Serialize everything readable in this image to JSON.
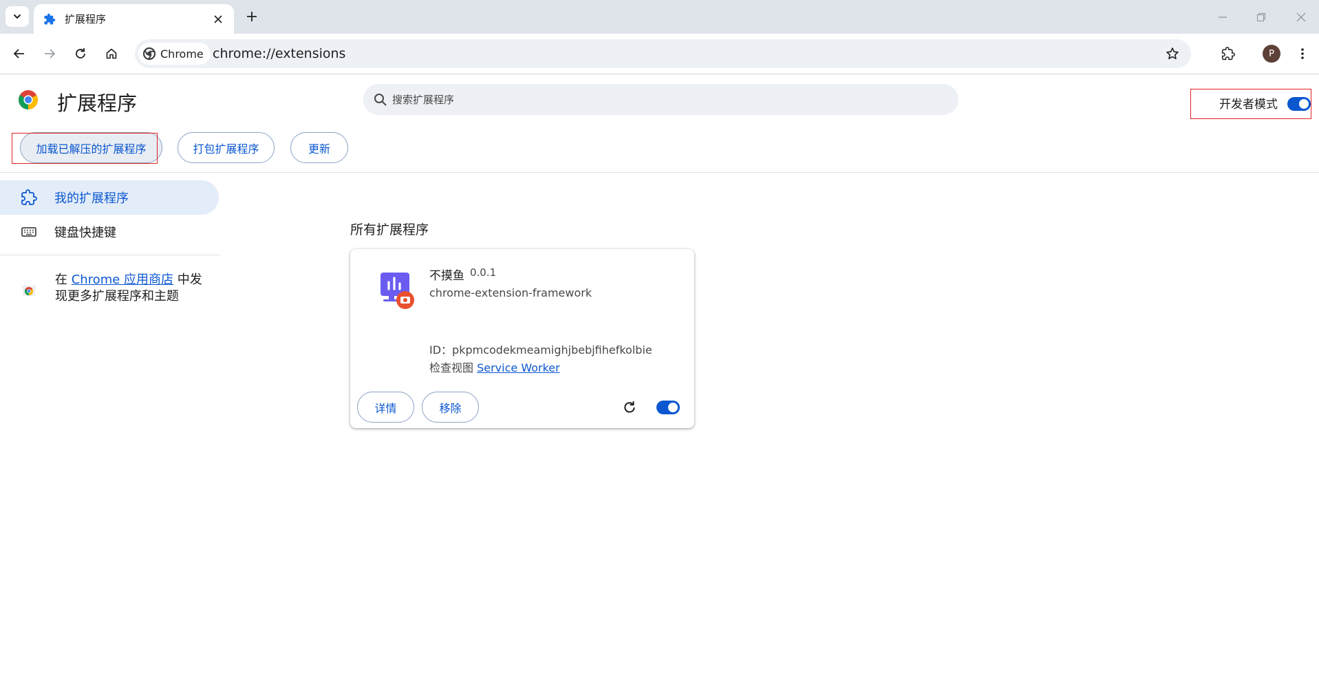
{
  "browser": {
    "tab_title": "扩展程序",
    "omnibox_chip": "Chrome",
    "url": "chrome://extensions",
    "profile_initial": "P"
  },
  "header": {
    "title": "扩展程序",
    "search_placeholder": "搜索扩展程序",
    "dev_mode_label": "开发者模式",
    "dev_mode_on": true
  },
  "actions": {
    "load_unpacked": "加载已解压的扩展程序",
    "pack": "打包扩展程序",
    "update": "更新"
  },
  "sidebar": {
    "items": [
      {
        "label": "我的扩展程序",
        "active": true
      },
      {
        "label": "键盘快捷键",
        "active": false
      }
    ],
    "store_prefix": "在 ",
    "store_link": "Chrome 应用商店",
    "store_suffix": " 中发现更多扩展程序和主题"
  },
  "main": {
    "section_title": "所有扩展程序",
    "extension": {
      "name": "不摸鱼",
      "version": "0.0.1",
      "description": "chrome-extension-framework",
      "id_text": "ID：pkpmcodekmeamighjbebjfihefkolbie",
      "inspect_label": "检查视图 ",
      "inspect_link": "Service Worker",
      "details_label": "详情",
      "remove_label": "移除",
      "enabled": true
    }
  },
  "colors": {
    "accent": "#0b57d0",
    "highlight_box": "#e02020",
    "icon_purple": "#6a5cf0",
    "icon_badge": "#e8502e"
  }
}
